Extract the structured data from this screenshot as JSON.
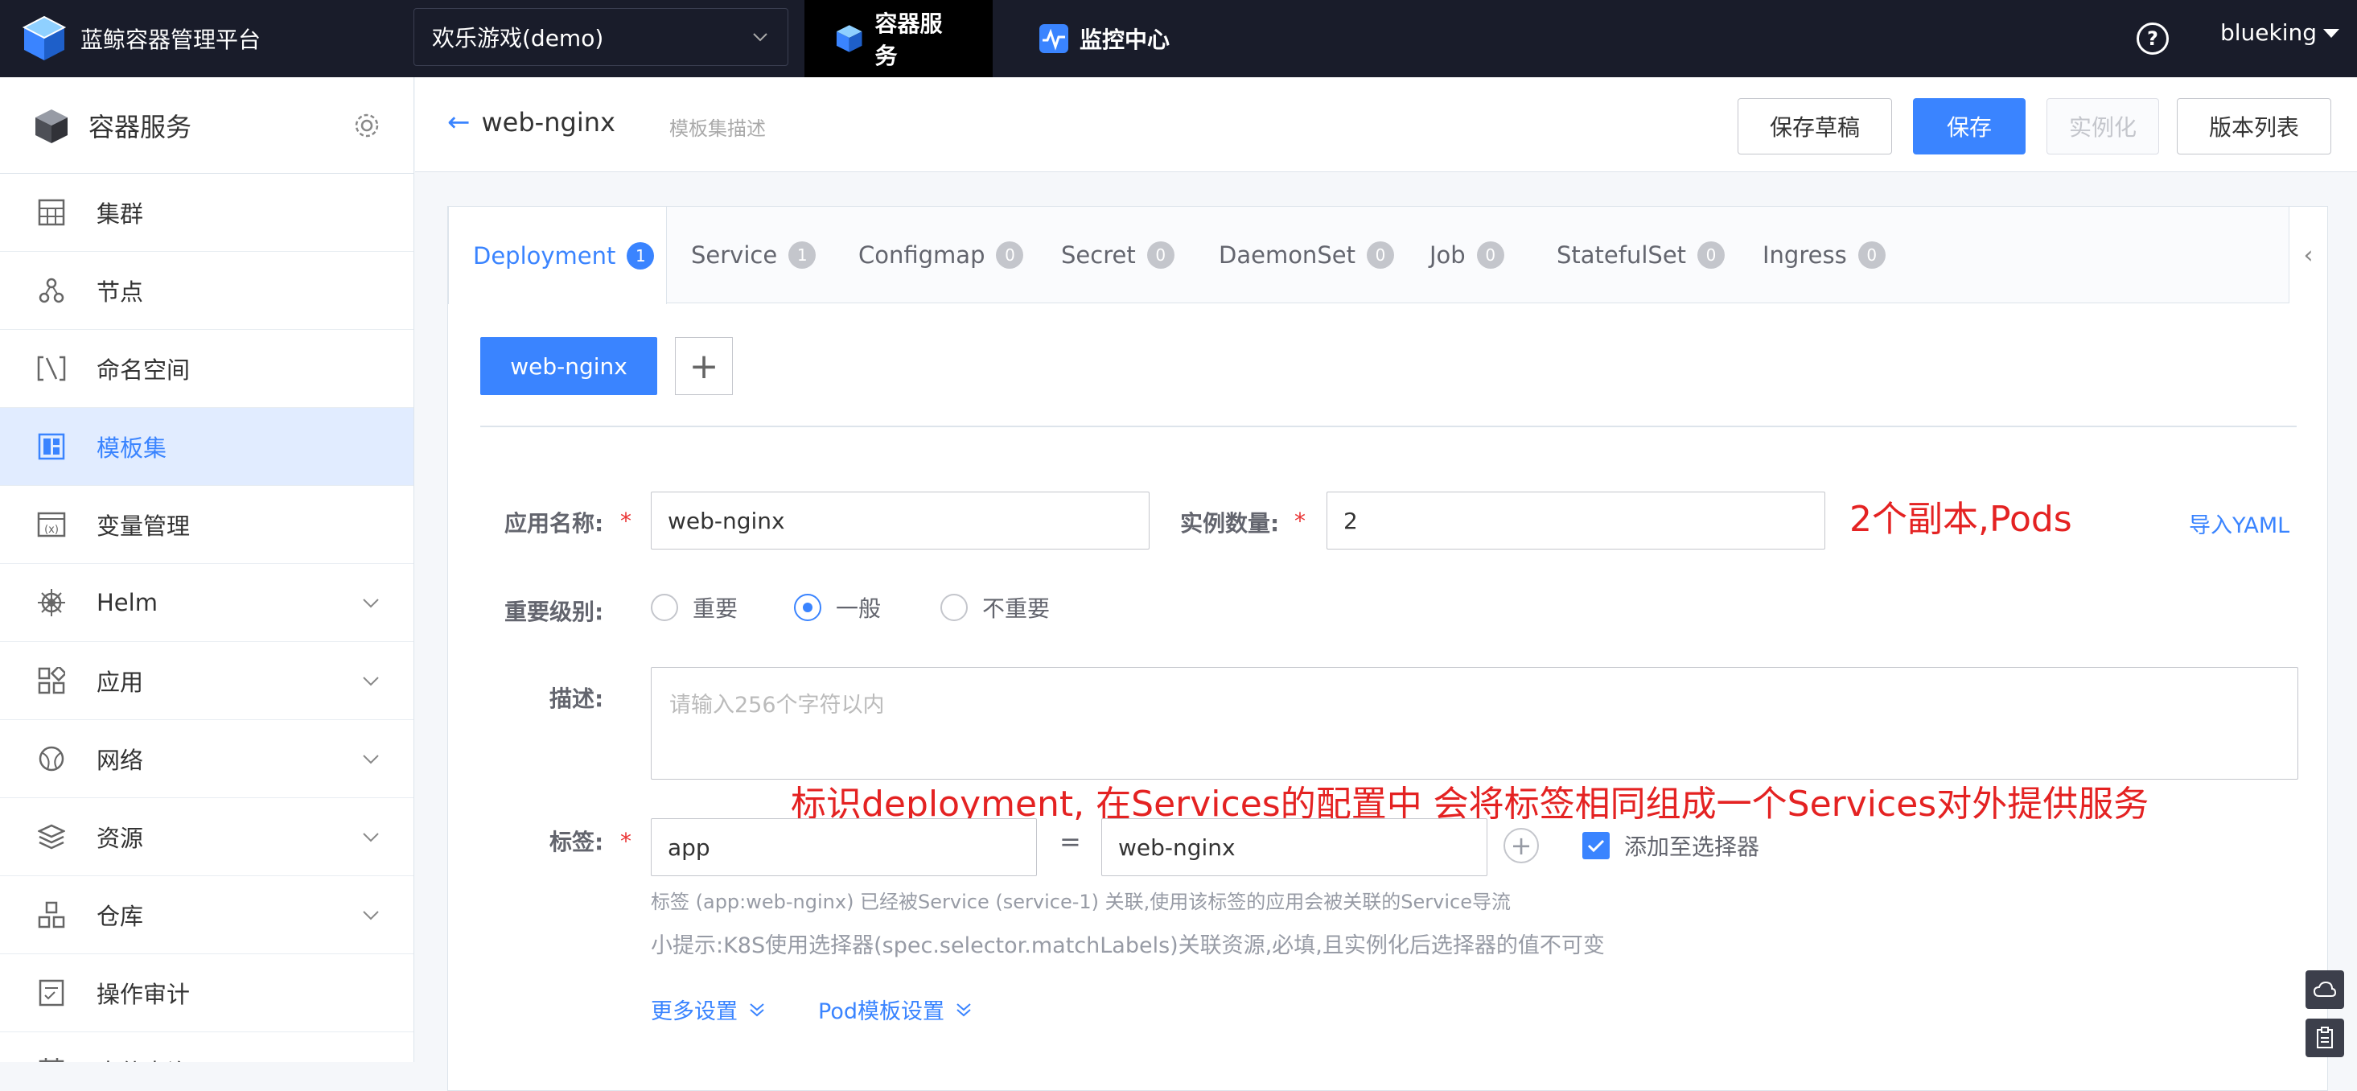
{
  "brand": {
    "title": "蓝鲸容器管理平台"
  },
  "project": {
    "selected": "欢乐游戏(demo)"
  },
  "topnav": [
    {
      "label": "容器服务",
      "icon": "cube-icon",
      "active": true
    },
    {
      "label": "监控中心",
      "icon": "monitor-icon",
      "active": false
    }
  ],
  "user": {
    "name": "blueking"
  },
  "help": {
    "glyph": "?"
  },
  "sidebar": {
    "title": "容器服务",
    "items": [
      {
        "label": "集群",
        "icon": "cluster-icon"
      },
      {
        "label": "节点",
        "icon": "node-icon"
      },
      {
        "label": "命名空间",
        "icon": "namespace-icon"
      },
      {
        "label": "模板集",
        "icon": "template-icon",
        "active": true
      },
      {
        "label": "变量管理",
        "icon": "variable-icon"
      },
      {
        "label": "Helm",
        "icon": "helm-icon",
        "expandable": true
      },
      {
        "label": "应用",
        "icon": "app-icon",
        "expandable": true
      },
      {
        "label": "网络",
        "icon": "network-icon",
        "expandable": true
      },
      {
        "label": "资源",
        "icon": "resource-icon",
        "expandable": true
      },
      {
        "label": "仓库",
        "icon": "repo-icon",
        "expandable": true
      },
      {
        "label": "操作审计",
        "icon": "audit-icon"
      },
      {
        "label": "事件查询",
        "icon": "event-icon"
      }
    ]
  },
  "header": {
    "title": "web-nginx",
    "desc_placeholder": "模板集描述",
    "buttons": {
      "draft": "保存草稿",
      "save": "保存",
      "instantiate": "实例化",
      "versions": "版本列表"
    }
  },
  "tabs": [
    {
      "label": "Deployment",
      "count": "1",
      "active": true
    },
    {
      "label": "Service",
      "count": "1"
    },
    {
      "label": "Configmap",
      "count": "0"
    },
    {
      "label": "Secret",
      "count": "0"
    },
    {
      "label": "DaemonSet",
      "count": "0"
    },
    {
      "label": "Job",
      "count": "0"
    },
    {
      "label": "StatefulSet",
      "count": "0"
    },
    {
      "label": "Ingress",
      "count": "0"
    }
  ],
  "app_tab": {
    "label": "web-nginx"
  },
  "form": {
    "app_name_label": "应用名称:",
    "app_name_value": "web-nginx",
    "replicas_label": "实例数量:",
    "replicas_value": "2",
    "import_yaml": "导入YAML",
    "importance_label": "重要级别:",
    "importance_options": [
      "重要",
      "一般",
      "不重要"
    ],
    "importance_selected": "一般",
    "desc_label": "描述:",
    "desc_placeholder": "请输入256个字符以内",
    "labels_label": "标签:",
    "label_key": "app",
    "label_eq": "=",
    "label_value": "web-nginx",
    "add_to_selector": "添加至选择器",
    "label_note": "标签 (app:web-nginx) 已经被Service (service-1) 关联,使用该标签的应用会被关联的Service导流",
    "tip": "小提示:K8S使用选择器(spec.selector.matchLabels)关联资源,必填,且实例化后选择器的值不可变",
    "more_settings": "更多设置",
    "pod_template": "Pod模板设置"
  },
  "annotations": {
    "replicas_note": "2个副本,Pods",
    "labels_note": "标识deployment, 在Services的配置中 会将标签相同组成一个Services对外提供服务"
  },
  "required_mark": "*"
}
